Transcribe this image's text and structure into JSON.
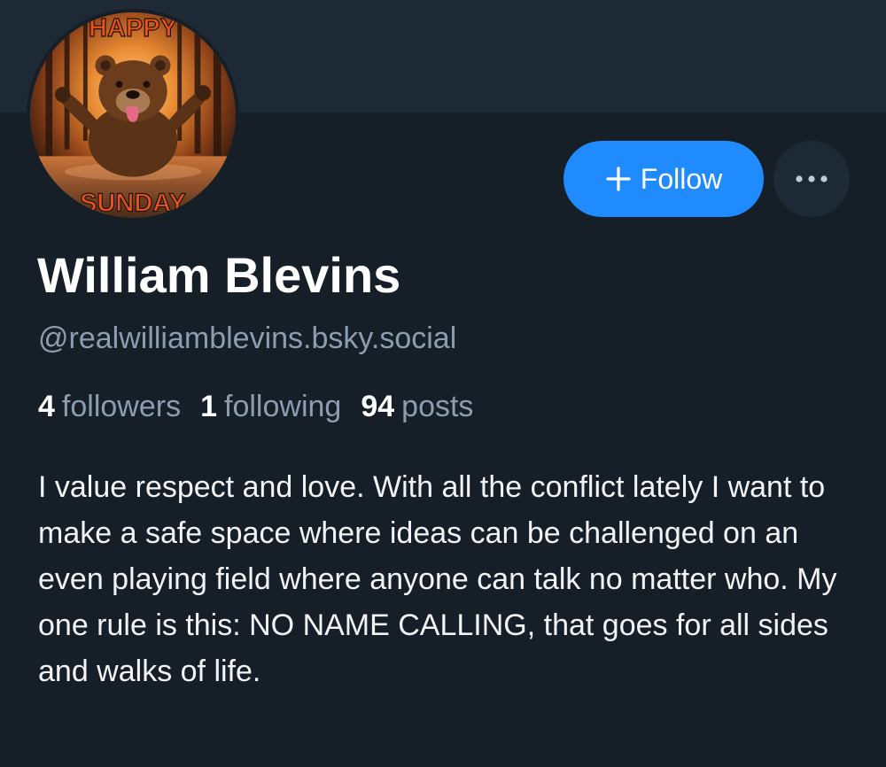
{
  "profile": {
    "display_name": "William Blevins",
    "handle": "@realwilliamblevins.bsky.social",
    "bio": "I value respect and love. With all the conflict lately I want to make a safe space where ideas can be challenged on an even playing field where anyone can talk no matter who. My one rule is this: NO NAME CALLING, that goes for all sides and walks of life.",
    "avatar": {
      "top_text": "HAPPY",
      "bottom_text": "SUNDAY",
      "description_icon": "bear-avatar"
    }
  },
  "stats": {
    "followers": {
      "count": "4",
      "label": "followers"
    },
    "following": {
      "count": "1",
      "label": "following"
    },
    "posts": {
      "count": "94",
      "label": "posts"
    }
  },
  "actions": {
    "follow_label": "Follow",
    "follow_icon": "plus-icon",
    "more_icon": "ellipsis-icon"
  },
  "colors": {
    "background": "#161e27",
    "banner": "#1e2936",
    "accent": "#208bfe",
    "muted_text": "#8d9cae",
    "primary_text": "#ffffff"
  }
}
